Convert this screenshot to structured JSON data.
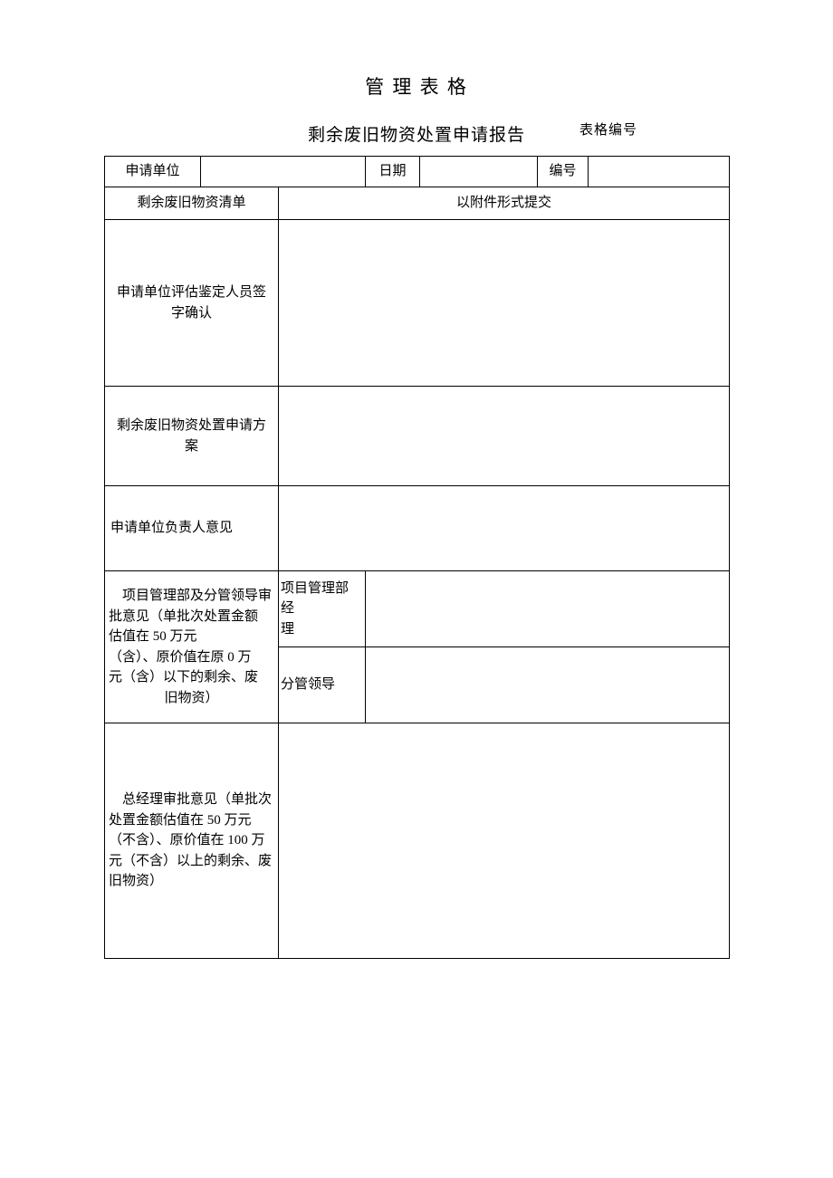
{
  "header": {
    "main_title": "管 理 表 格",
    "subtitle": "剩余废旧物资处置申请报告",
    "form_number_label": "表格编号"
  },
  "row1": {
    "label_apply_unit": "申请单位",
    "value_apply_unit": "",
    "label_date": "日期",
    "value_date": "",
    "label_no": "编号",
    "value_no": ""
  },
  "row2": {
    "label_inventory": "剩余废旧物资清单",
    "value_attachment": "以附件形式提交"
  },
  "row3": {
    "label_line1": "申请单位评估鉴定人员签",
    "label_line2": "字确认",
    "value": ""
  },
  "row4": {
    "label_line1": "剩余废旧物资处置申请方",
    "label_line2": "案",
    "value": ""
  },
  "row5": {
    "label": "申请单位负责人意见",
    "value": ""
  },
  "row6": {
    "label_line1": "项目管理部及分管领导审",
    "label_line2": "批意见（单批次处置金额",
    "label_line3": "估值在 50 万元",
    "label_line4": "（含）、原价值在原 0 万",
    "label_line5": "元（含）以下的剩余、废",
    "label_line6": "旧物资）",
    "sub1_label_line1": "项目管理部经",
    "sub1_label_line2": "理",
    "sub1_value": "",
    "sub2_label": "分管领导",
    "sub2_value": ""
  },
  "row7": {
    "label_line1": "总经理审批意见（单批次",
    "label_line2": "处置金额估值在 50 万元",
    "label_line3": "（不含）、原价值在 100 万",
    "label_line4": "元（不含）以上的剩余、废",
    "label_line5": "旧物资）",
    "value": ""
  }
}
